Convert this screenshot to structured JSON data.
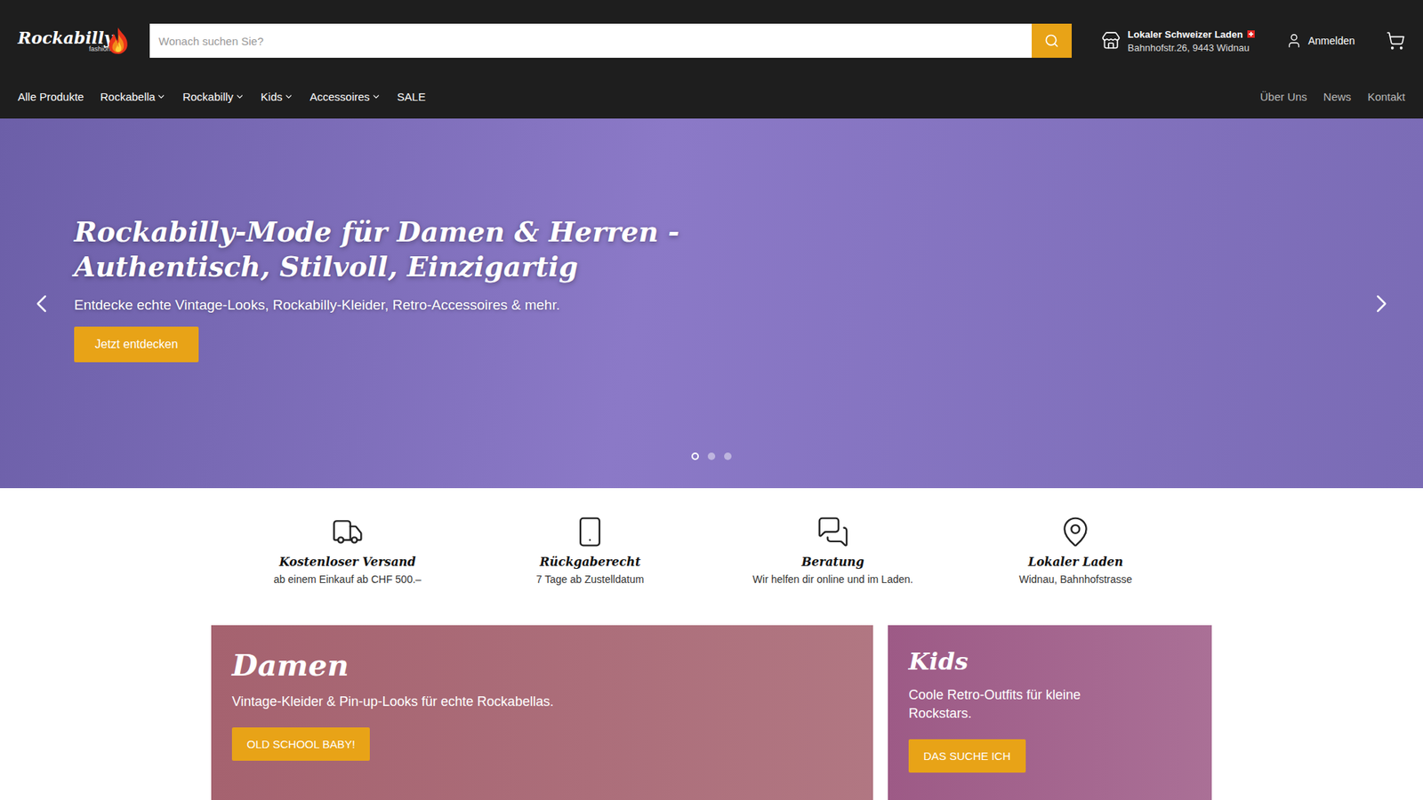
{
  "header": {
    "logo": {
      "title": "Rockabilly",
      "subtitle": "fashion"
    },
    "search": {
      "placeholder": "Wonach suchen Sie?"
    },
    "store": {
      "title": "Lokaler Schweizer Laden",
      "address": "Bahnhofstr.26, 9443 Widnau"
    },
    "account": {
      "label": "Anmelden"
    }
  },
  "nav": {
    "items": [
      {
        "label": "Alle Produkte",
        "dropdown": false
      },
      {
        "label": "Rockabella",
        "dropdown": true
      },
      {
        "label": "Rockabilly",
        "dropdown": true
      },
      {
        "label": "Kids",
        "dropdown": true
      },
      {
        "label": "Accessoires",
        "dropdown": true
      },
      {
        "label": "SALE",
        "dropdown": false
      }
    ],
    "secondary": [
      {
        "label": "Über Uns"
      },
      {
        "label": "News"
      },
      {
        "label": "Kontakt"
      }
    ]
  },
  "hero": {
    "title": "Rockabilly-Mode für Damen & Herren - Authentisch, Stilvoll, Einzigartig",
    "subtitle": "Entdecke echte Vintage-Looks, Rockabilly-Kleider, Retro-Accessoires & mehr.",
    "button": "Jetzt entdecken",
    "slides": [
      {
        "selected": true
      },
      {
        "selected": false
      },
      {
        "selected": false
      }
    ]
  },
  "features": [
    {
      "title": "Kostenloser Versand",
      "text": "ab einem Einkauf ab CHF 500.–"
    },
    {
      "title": "Rückgaberecht",
      "text": "7 Tage ab Zustelldatum"
    },
    {
      "title": "Beratung",
      "text": "Wir helfen dir online und im Laden."
    },
    {
      "title": "Lokaler Laden",
      "text": "Widnau, Bahnhofstrasse"
    }
  ],
  "cards": [
    {
      "title": "Damen",
      "text": "Vintage-Kleider & Pin-up-Looks für echte Rockabellas.",
      "button": "OLD SCHOOL BABY!",
      "color": "#a5626f"
    },
    {
      "title": "Kids",
      "text": "Coole Retro-Outfits für kleine Rockstars.",
      "button": "DAS SUCHE ICH",
      "color": "#9d5a86"
    }
  ]
}
